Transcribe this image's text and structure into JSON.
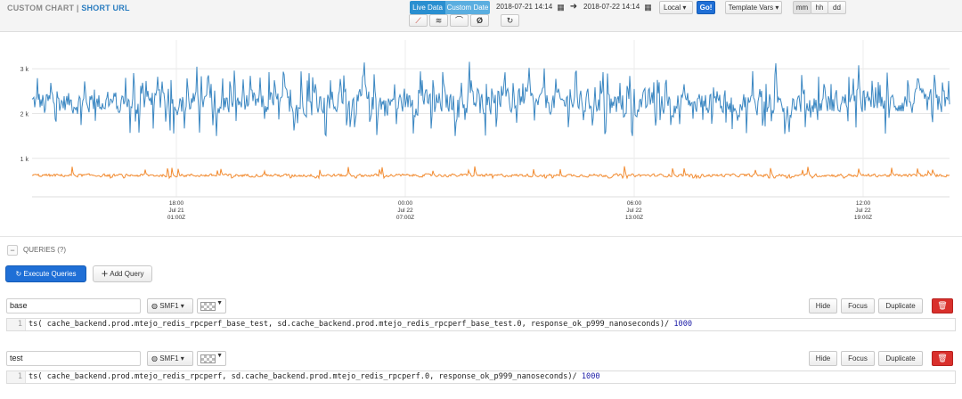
{
  "topbar": {
    "brand_custom": "CUSTOM CHART",
    "brand_sep": " | ",
    "brand_short": "SHORT URL",
    "live_data": "Live Data",
    "custom_date": "Custom Date",
    "start_time": "2018-07-21 14:14",
    "end_time": "2018-07-22 14:14",
    "timezone": "Local",
    "go": "Go!",
    "template_vars": "Template Vars",
    "granularity": [
      "mm",
      "hh",
      "dd"
    ],
    "accent_color": "#2a8fd0"
  },
  "toolbar_icons": [
    "line-chart-icon",
    "stacked-chart-icon",
    "spline-icon",
    "zero-icon",
    "refresh-icon"
  ],
  "chart_data": {
    "type": "line",
    "y_tick_labels": [
      "3 k",
      "2 k",
      "1 k"
    ],
    "y_ticks": [
      3000,
      2000,
      1000
    ],
    "ylim": [
      300,
      3800
    ],
    "x_ticks": [
      {
        "line1": "18:00",
        "line2": "Jul 21",
        "line3": "01:00Z"
      },
      {
        "line1": "00:00",
        "line2": "Jul 22",
        "line3": "07:00Z"
      },
      {
        "line1": "06:00",
        "line2": "Jul 22",
        "line3": "13:00Z"
      },
      {
        "line1": "12:00",
        "line2": "Jul 22",
        "line3": "19:00Z"
      }
    ],
    "series": [
      {
        "color": "#3b87c2",
        "approx_mean": 2250,
        "approx_min": 1500,
        "approx_max": 3300
      },
      {
        "color": "#f28b30",
        "approx_mean": 620,
        "approx_min": 560,
        "approx_max": 1000
      }
    ],
    "grid": true
  },
  "queries": {
    "header": "QUERIES",
    "help": "(?)",
    "execute_label": "Execute Queries",
    "add_label": "Add Query",
    "items": [
      {
        "name": "base",
        "format": "SMF1",
        "line_no": "1",
        "expr_prefix": "ts( cache_backend.prod.mtejo_redis_rpcperf_base_test, sd.cache_backend.prod.mtejo_redis_rpcperf_base_test.0, response_ok_p999_nanoseconds)/ ",
        "expr_num": "1000"
      },
      {
        "name": "test",
        "format": "SMF1",
        "line_no": "1",
        "expr_prefix": "ts( cache_backend.prod.mtejo_redis_rpcperf, sd.cache_backend.prod.mtejo_redis_rpcperf.0, response_ok_p999_nanoseconds)/ ",
        "expr_num": "1000"
      }
    ],
    "hide": "Hide",
    "focus": "Focus",
    "duplicate": "Duplicate"
  }
}
